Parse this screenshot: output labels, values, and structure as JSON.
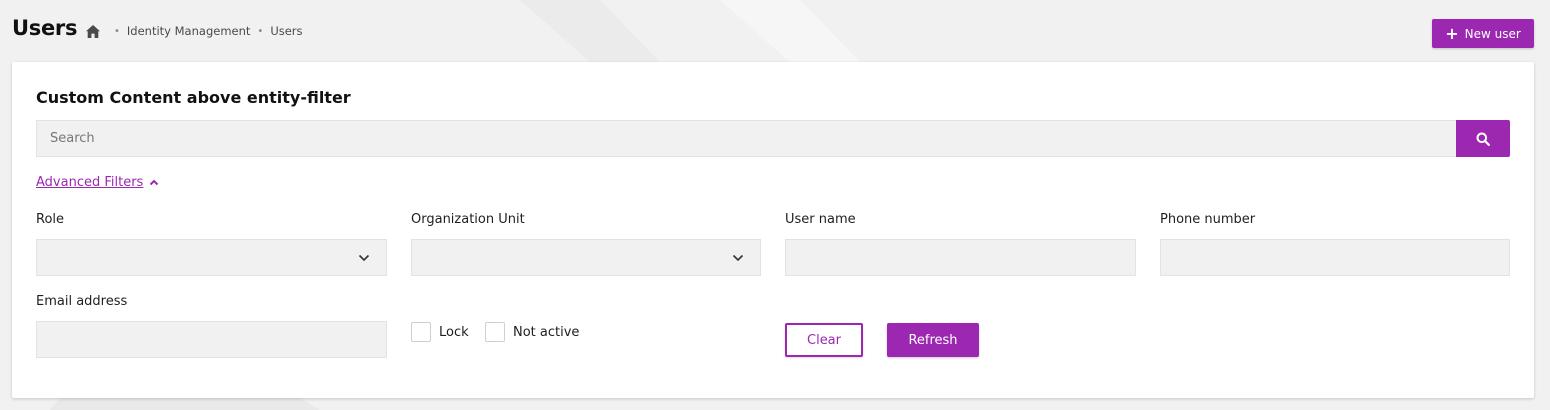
{
  "header": {
    "title": "Users",
    "breadcrumb": [
      {
        "label": "Identity Management"
      },
      {
        "label": "Users"
      }
    ],
    "new_user_label": "New user"
  },
  "card": {
    "custom_heading": "Custom Content above entity-filter",
    "search": {
      "placeholder": "Search",
      "value": ""
    },
    "advanced_filters_label": "Advanced Filters",
    "filters": {
      "role": {
        "label": "Role",
        "value": ""
      },
      "organization_unit": {
        "label": "Organization Unit",
        "value": ""
      },
      "user_name": {
        "label": "User name",
        "value": ""
      },
      "phone_number": {
        "label": "Phone number",
        "value": ""
      },
      "email_address": {
        "label": "Email address",
        "value": ""
      },
      "lock": {
        "label": "Lock",
        "checked": false
      },
      "not_active": {
        "label": "Not active",
        "checked": false
      }
    },
    "clear_label": "Clear",
    "refresh_label": "Refresh"
  },
  "theme": {
    "accent": "#9c27b0",
    "background": "#f1f1f1",
    "card": "#ffffff",
    "input_bg": "#f1f1f1"
  },
  "icons": {
    "home": "home-icon",
    "search": "search-icon",
    "plus": "plus-icon",
    "chevron_up": "chevron-up-icon",
    "chevron_down": "chevron-down-icon"
  }
}
